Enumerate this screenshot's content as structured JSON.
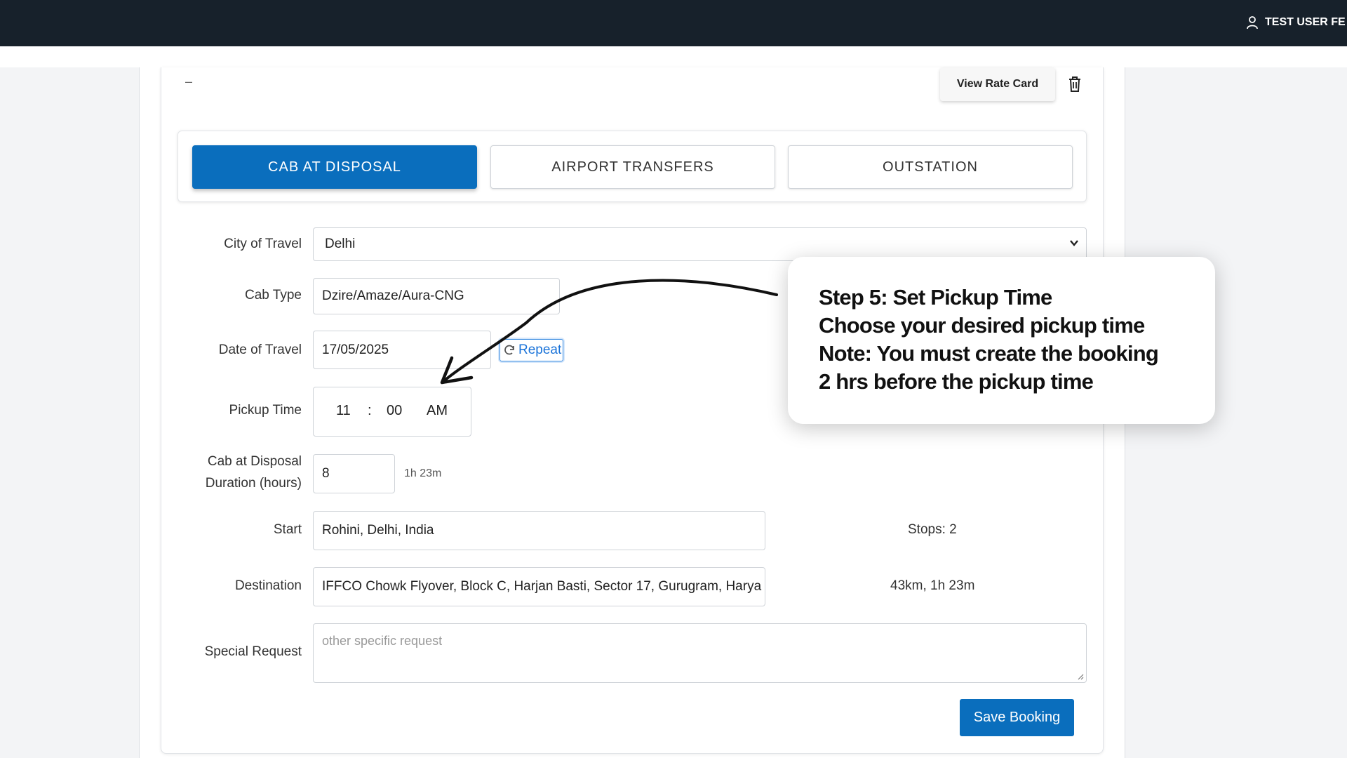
{
  "header": {
    "user_label": "TEST USER FE"
  },
  "actions": {
    "dash": "–",
    "view_rate_card": "View Rate Card"
  },
  "tabs": [
    {
      "label": "CAB AT DISPOSAL",
      "active": true
    },
    {
      "label": "AIRPORT TRANSFERS",
      "active": false
    },
    {
      "label": "OUTSTATION",
      "active": false
    }
  ],
  "form": {
    "city": {
      "label": "City of Travel",
      "value": "Delhi"
    },
    "cab_type": {
      "label": "Cab Type",
      "value": "Dzire/Amaze/Aura-CNG"
    },
    "date": {
      "label": "Date of Travel",
      "value": "17/05/2025",
      "repeat_label": "Repeat"
    },
    "pickup": {
      "label": "Pickup Time",
      "hour": "11",
      "separator": ":",
      "minute": "00",
      "ampm": "AM"
    },
    "duration": {
      "label_line1": "Cab at Disposal",
      "label_line2": "Duration (hours)",
      "value": "8",
      "hint": "1h 23m"
    },
    "start": {
      "label": "Start",
      "value": "Rohini, Delhi, India",
      "side_info": "Stops: 2"
    },
    "destination": {
      "label": "Destination",
      "value": "IFFCO Chowk Flyover, Block C, Harjan Basti, Sector 17, Gurugram, Harya",
      "side_info": "43km, 1h 23m"
    },
    "special_request": {
      "label": "Special Request",
      "placeholder": "other specific request"
    }
  },
  "save_label": "Save Booking",
  "callout": {
    "line1": "Step 5: Set Pickup Time",
    "line2": "Choose your desired pickup time",
    "line3": "Note: You must create the booking",
    "line4": "2 hrs before the pickup time"
  },
  "colors": {
    "topbar": "#17212b",
    "primary": "#0a6ebd",
    "link": "#1a73d9"
  }
}
